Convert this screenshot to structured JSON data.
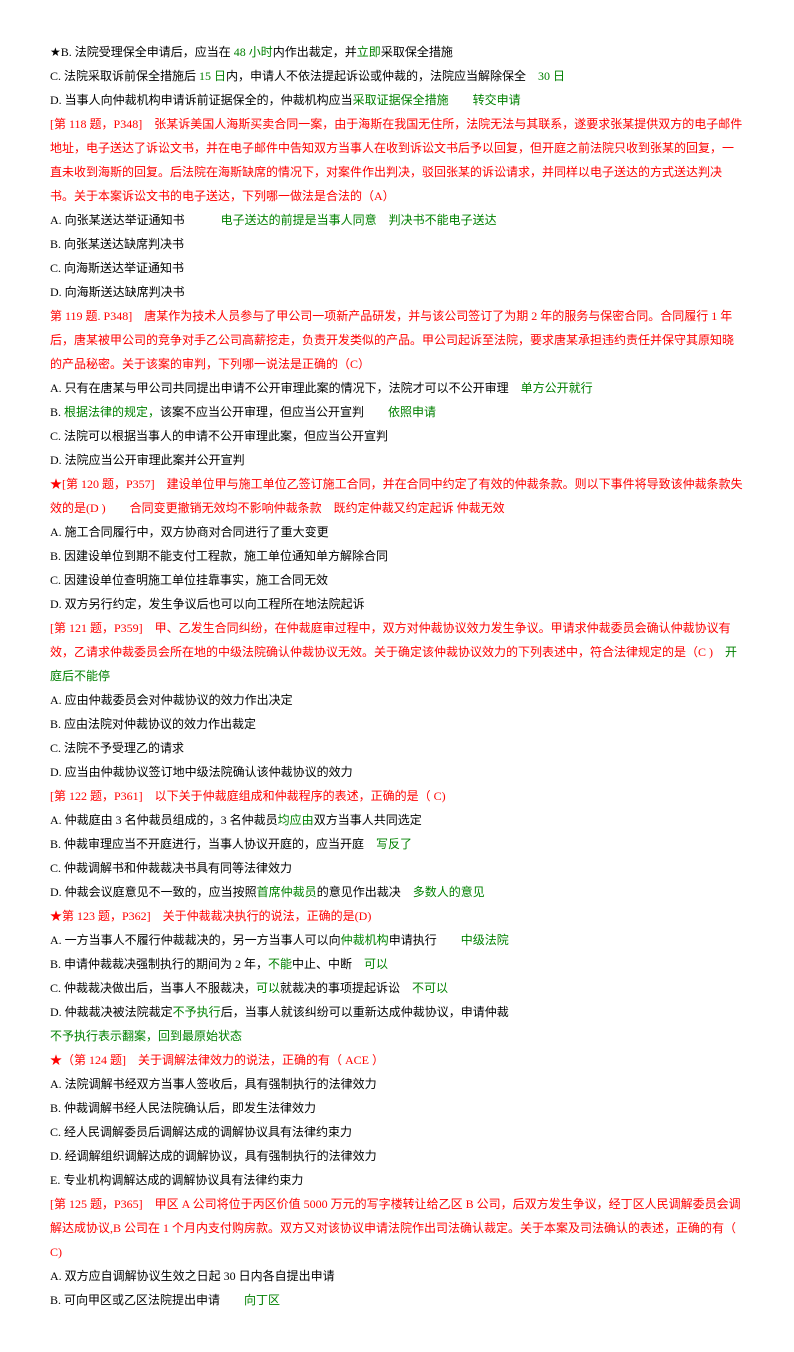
{
  "lines": [
    {
      "parts": [
        {
          "t": "★B. 法院受理保全申请后，应当在 ",
          "c": "black"
        },
        {
          "t": "48 小时",
          "c": "green"
        },
        {
          "t": "内作出裁定，并",
          "c": "black"
        },
        {
          "t": "立即",
          "c": "green"
        },
        {
          "t": "采取保全措施",
          "c": "black"
        }
      ]
    },
    {
      "parts": [
        {
          "t": "C. 法院采取诉前保全措施后 ",
          "c": "black"
        },
        {
          "t": "15 日",
          "c": "green"
        },
        {
          "t": "内，申请人不依法提起诉讼或仲裁的，法院应当解除保全　",
          "c": "black"
        },
        {
          "t": "30 日",
          "c": "green"
        }
      ]
    },
    {
      "parts": [
        {
          "t": "D. 当事人向仲裁机构申请诉前证据保全的，仲裁机构应当",
          "c": "black"
        },
        {
          "t": "采取证据保全措施　　转交申请",
          "c": "green"
        }
      ]
    },
    {
      "parts": [
        {
          "t": "[第 118 题，P348]　张某诉美国人海斯买卖合同一案，由于海斯在我国无住所，法院无法与其联系，遂要求张某提供双方的电子邮件地址，电子送达了诉讼文书，并在电子邮件中告知双方当事人在收到诉讼文书后予以回复，但开庭之前法院只收到张某的回复，一直未收到海斯的回复。后法院在海斯缺席的情况下，对案件作出判决，驳回张某的诉讼请求，并同样以电子送达的方式送达判决书。关于本案诉讼文书的电子送达，下列哪一做法是合法的（A）",
          "c": "red"
        }
      ]
    },
    {
      "parts": [
        {
          "t": "A. 向张某送达举证通知书　　　",
          "c": "black"
        },
        {
          "t": "电子送达的前提是当事人同意　判决书不能电子送达",
          "c": "green"
        }
      ]
    },
    {
      "parts": [
        {
          "t": "B. 向张某送达缺席判决书",
          "c": "black"
        }
      ]
    },
    {
      "parts": [
        {
          "t": "C. 向海斯送达举证通知书",
          "c": "black"
        }
      ]
    },
    {
      "parts": [
        {
          "t": "D. 向海斯送达缺席判决书",
          "c": "black"
        }
      ]
    },
    {
      "parts": [
        {
          "t": "第 119 题. P348]　",
          "c": "red"
        },
        {
          "t": "唐某作为技术人员参与了甲公司一项新产品研发，并与该公司签订了为期 2 年的服务与保密合同。合同履行 1 年后，唐某被甲公司的竞争对手乙公司高薪挖走，负责开发类似的产品。甲公司起诉至法院，要求唐某承担违约责任并保守其原知晓的产品秘密。关于该案的审判，下列哪一说法是正确的（C）",
          "c": "red"
        }
      ]
    },
    {
      "parts": [
        {
          "t": "A. 只有在唐某与甲公司共同提出申请不公开审理此案的情况下，法院才可以不公开审理　",
          "c": "black"
        },
        {
          "t": "单方公开就行",
          "c": "green"
        }
      ]
    },
    {
      "parts": [
        {
          "t": "B. ",
          "c": "black"
        },
        {
          "t": "根据法律的规定，",
          "c": "green"
        },
        {
          "t": "该案不应当公开审理，但应当公开宣判　　",
          "c": "black"
        },
        {
          "t": "依照申请",
          "c": "green"
        }
      ]
    },
    {
      "parts": [
        {
          "t": "C. 法院可以根据当事人的申请不公开审理此案，但应当公开宣判",
          "c": "black"
        }
      ]
    },
    {
      "parts": [
        {
          "t": "D. 法院应当公开审理此案并公开宣判",
          "c": "black"
        }
      ]
    },
    {
      "parts": [
        {
          "t": "★[第 120 题，P357]　建设单位甲与施工单位乙签订施工合同，并在合同中约定了有效的仲裁条款。则以下事件将导致该仲裁条款失效的是(D )　　合同变更撤销无效均不影响仲裁条款　既约定仲裁又约定起诉 仲裁无效",
          "c": "red"
        }
      ]
    },
    {
      "parts": [
        {
          "t": "A. 施工合同履行中，双方协商对合同进行了重大变更",
          "c": "black"
        }
      ]
    },
    {
      "parts": [
        {
          "t": "B. 因建设单位到期不能支付工程款，施工单位通知单方解除合同",
          "c": "black"
        }
      ]
    },
    {
      "parts": [
        {
          "t": "C. 因建设单位查明施工单位挂靠事实，施工合同无效",
          "c": "black"
        }
      ]
    },
    {
      "parts": [
        {
          "t": "D. 双方另行约定，发生争议后也可以向工程所在地法院起诉",
          "c": "black"
        }
      ]
    },
    {
      "parts": [
        {
          "t": "[第 121 题，P359]　甲、乙发生合同纠纷，在仲裁庭审过程中，双方对仲裁协议效力发生争议。甲请求仲裁委员会确认仲裁协议有效，乙请求仲裁委员会所在地的中级法院确认仲裁协议无效。关于确定该仲裁协议效力的下列表述中，符合法律规定的是（C )　",
          "c": "red"
        },
        {
          "t": "开庭后不能停",
          "c": "green"
        }
      ]
    },
    {
      "parts": [
        {
          "t": "A. 应由仲裁委员会对仲裁协议的效力作出决定",
          "c": "black"
        }
      ]
    },
    {
      "parts": [
        {
          "t": "B. 应由法院对仲裁协议的效力作出裁定",
          "c": "black"
        }
      ]
    },
    {
      "parts": [
        {
          "t": "C. 法院不予受理乙的请求",
          "c": "black"
        }
      ]
    },
    {
      "parts": [
        {
          "t": "D. 应当由仲裁协议签订地中级法院确认该仲裁协议的效力",
          "c": "black"
        }
      ]
    },
    {
      "parts": [
        {
          "t": "[第 122 题，P361]　以下关于仲裁庭组成和仲裁程序的表述，正确的是（ C)",
          "c": "red"
        }
      ]
    },
    {
      "parts": [
        {
          "t": "A. 仲裁庭由 3 名仲裁员组成的，3 名仲裁员",
          "c": "black"
        },
        {
          "t": "均应由",
          "c": "green"
        },
        {
          "t": "双方当事人共同选定",
          "c": "black"
        }
      ]
    },
    {
      "parts": [
        {
          "t": "B. 仲裁审理应当不开庭进行，当事人协议开庭的，应当开庭　",
          "c": "black"
        },
        {
          "t": "写反了",
          "c": "green"
        }
      ]
    },
    {
      "parts": [
        {
          "t": "C. 仲裁调解书和仲裁裁决书具有同等法律效力",
          "c": "black"
        }
      ]
    },
    {
      "parts": [
        {
          "t": "D. 仲裁会议庭意见不一致的，应当按照",
          "c": "black"
        },
        {
          "t": "首席仲裁员",
          "c": "green"
        },
        {
          "t": "的意见作出裁决　",
          "c": "black"
        },
        {
          "t": "多数人的意见",
          "c": "green"
        }
      ]
    },
    {
      "parts": [
        {
          "t": "★第 123 题，P362]　关于仲裁裁决执行的说法，正确的是(D)",
          "c": "red"
        }
      ]
    },
    {
      "parts": [
        {
          "t": "A. 一方当事人不履行仲裁裁决的，另一方当事人可以向",
          "c": "black"
        },
        {
          "t": "仲裁机构",
          "c": "green"
        },
        {
          "t": "申请执行　　",
          "c": "black"
        },
        {
          "t": "中级法院",
          "c": "green"
        }
      ]
    },
    {
      "parts": [
        {
          "t": "B. 申请仲裁裁决强制执行的期间为 2 年，",
          "c": "black"
        },
        {
          "t": "不能",
          "c": "green"
        },
        {
          "t": "中止、中断　",
          "c": "black"
        },
        {
          "t": "可以",
          "c": "green"
        }
      ]
    },
    {
      "parts": [
        {
          "t": "C. 仲裁裁决做出后，当事人不服裁决，",
          "c": "black"
        },
        {
          "t": "可以",
          "c": "green"
        },
        {
          "t": "就裁决的事项提起诉讼　",
          "c": "black"
        },
        {
          "t": "不可以",
          "c": "green"
        }
      ]
    },
    {
      "parts": [
        {
          "t": "D. 仲裁裁决被法院裁定",
          "c": "black"
        },
        {
          "t": "不予执行",
          "c": "green"
        },
        {
          "t": "后，当事人就该纠纷可以重新达成仲裁协议，申请仲裁",
          "c": "black"
        }
      ]
    },
    {
      "parts": [
        {
          "t": "不予执行表示翻案，回到最原始状态",
          "c": "green"
        }
      ]
    },
    {
      "parts": [
        {
          "t": "★（第 124 题]　关于调解法律效力的说法，正确的有（ ACE ）",
          "c": "red"
        }
      ]
    },
    {
      "parts": [
        {
          "t": "A. 法院调解书经双方当事人签收后，具有强制执行的法律效力",
          "c": "black"
        }
      ]
    },
    {
      "parts": [
        {
          "t": "B. 仲裁调解书经人民法院确认后，即发生法律效力",
          "c": "black"
        }
      ]
    },
    {
      "parts": [
        {
          "t": "C. 经人民调解委员后调解达成的调解协议具有法律约束力",
          "c": "black"
        }
      ]
    },
    {
      "parts": [
        {
          "t": "D. 经调解组织调解达成的调解协议，具有强制执行的法律效力",
          "c": "black"
        }
      ]
    },
    {
      "parts": [
        {
          "t": "E. 专业机构调解达成的调解协议具有法律约束力",
          "c": "black"
        }
      ]
    },
    {
      "parts": [
        {
          "t": "[第 125 题，P365]　甲区 A 公司将位于丙区价值 5000 万元的写字楼转让给乙区 B 公司，后双方发生争议，经丁区人民调解委员会调解达成协议,B 公司在 1 个月内支付购房款。双方又对该协议申请法院作出司法确认裁定。关于本案及司法确认的表述，正确的有（ C)",
          "c": "red"
        }
      ]
    },
    {
      "parts": [
        {
          "t": "A. 双方应自调解协议生效之日起 30 日内各自提出申请",
          "c": "black"
        }
      ]
    },
    {
      "parts": [
        {
          "t": "B. 可向甲区或乙区法院提出申请　　",
          "c": "black"
        },
        {
          "t": "向丁区",
          "c": "green"
        }
      ]
    }
  ]
}
